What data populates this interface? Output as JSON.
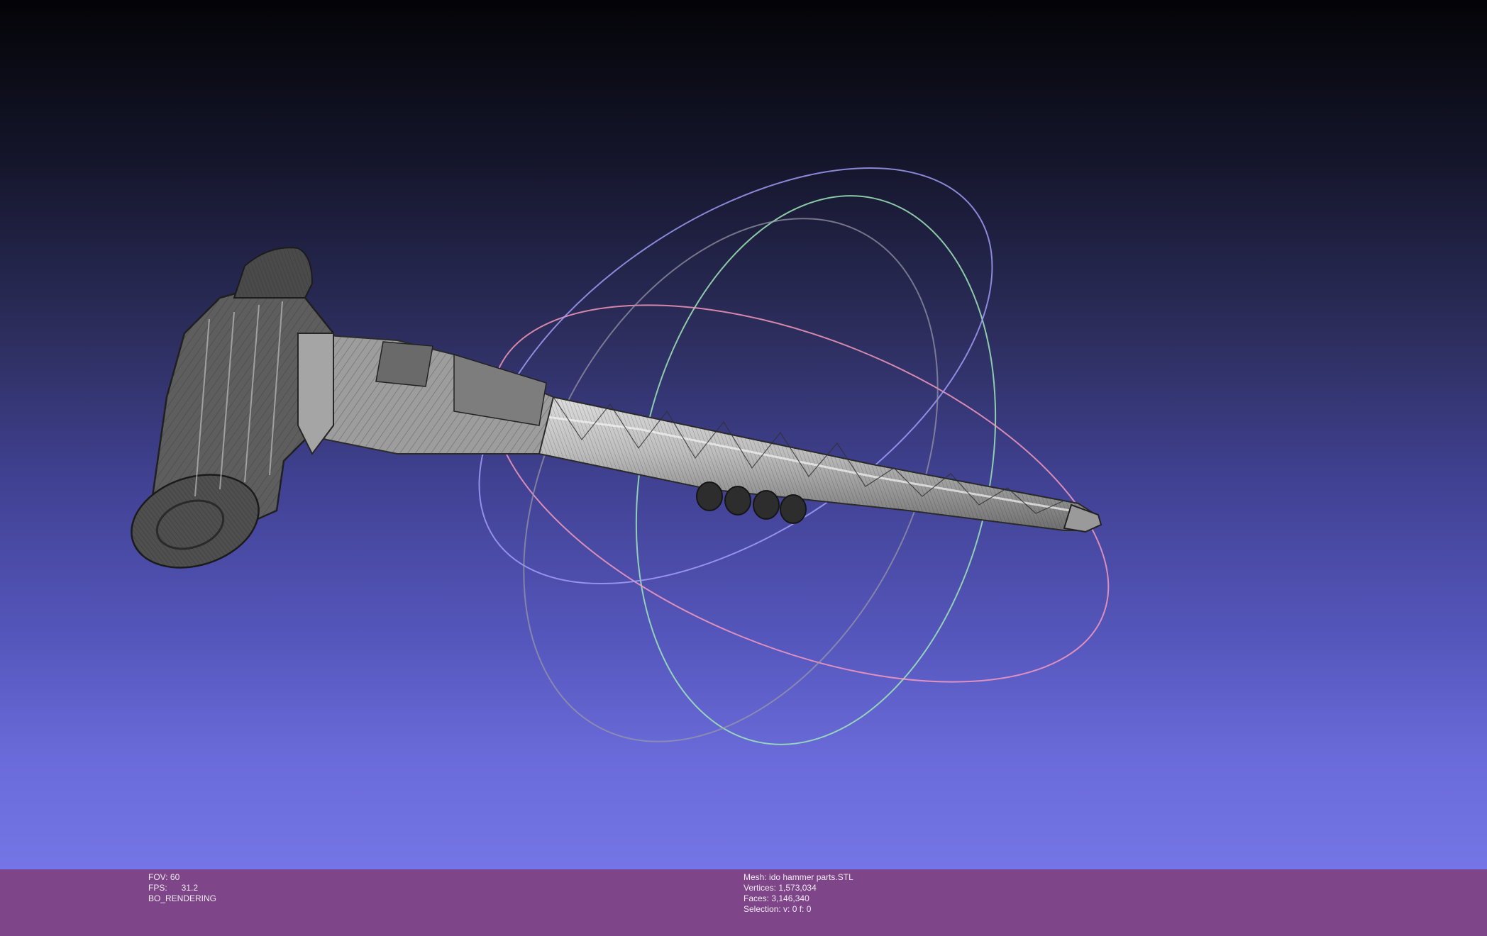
{
  "viewport": {
    "background_top": "#040407",
    "background_bottom": "#7475e6",
    "model_color": "#8b8b8b",
    "trackball_colors": {
      "x": "#9fe8b8",
      "y": "#a8a3ff",
      "z": "#ff9fbf",
      "neutral": "#9a9aa8"
    }
  },
  "status_bar": {
    "background": "#7e4688",
    "fov_label": "FOV:",
    "fov_value": "60",
    "fps_label": "FPS:",
    "fps_value": "31.2",
    "render_mode": "BO_RENDERING",
    "mesh_label": "Mesh:",
    "mesh_name": "ido hammer parts.STL",
    "vertices_label": "Vertices:",
    "vertices_value": "1,573,034",
    "faces_label": "Faces:",
    "faces_value": "3,146,340",
    "selection_label": "Selection:",
    "selection_value": "v: 0 f: 0"
  }
}
